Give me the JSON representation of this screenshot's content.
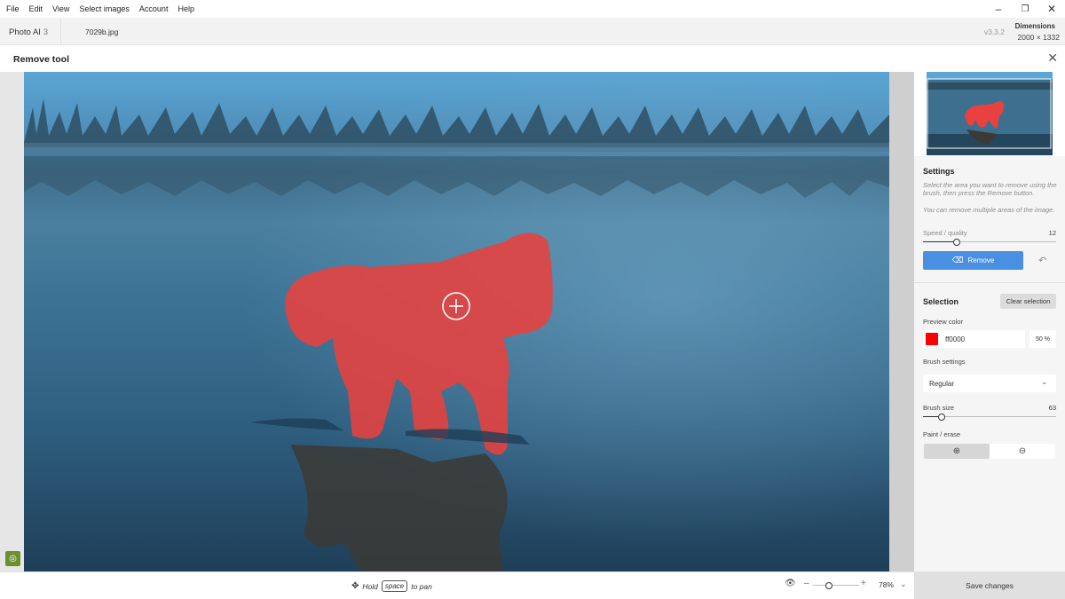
{
  "menu": [
    "File",
    "Edit",
    "View",
    "Select images",
    "Account",
    "Help"
  ],
  "window_controls": {
    "minimize": "–",
    "restore": "❐",
    "close": "✕"
  },
  "tabbar": {
    "app_name": "Photo AI",
    "app_count": "3",
    "filename": "7029b.jpg",
    "version": "v3.3.2",
    "dimensions_label": "Dimensions",
    "dimensions_value": "2000 × 1332"
  },
  "tool": {
    "title": "Remove tool",
    "close": "✕"
  },
  "settings": {
    "title": "Settings",
    "help1": "Select the area you want to remove using the brush, then press the Remove button.",
    "help2": "You can remove multiple areas of the image.",
    "speed_label": "Speed / quality",
    "speed_value": "12",
    "speed_fraction": 0.25,
    "remove_label": "Remove"
  },
  "selection": {
    "title": "Selection",
    "clear_label": "Clear selection",
    "preview_color_label": "Preview color",
    "preview_color": "#ff0000",
    "preview_color_text": "ff0000",
    "opacity_text": "50 %",
    "brush_settings_label": "Brush settings",
    "brush_mode": "Regular",
    "brush_size_label": "Brush size",
    "brush_size_value": "63",
    "brush_size_fraction": 0.14,
    "paint_erase_label": "Paint / erase"
  },
  "bottom": {
    "hint_hold": "Hold",
    "hint_key": "space",
    "hint_pan": "to pan",
    "zoom_value": "78%",
    "zoom_fraction": 0.2,
    "save_label": "Save changes"
  },
  "colors": {
    "accent": "#4a90e2",
    "mask": "#e8413f"
  }
}
